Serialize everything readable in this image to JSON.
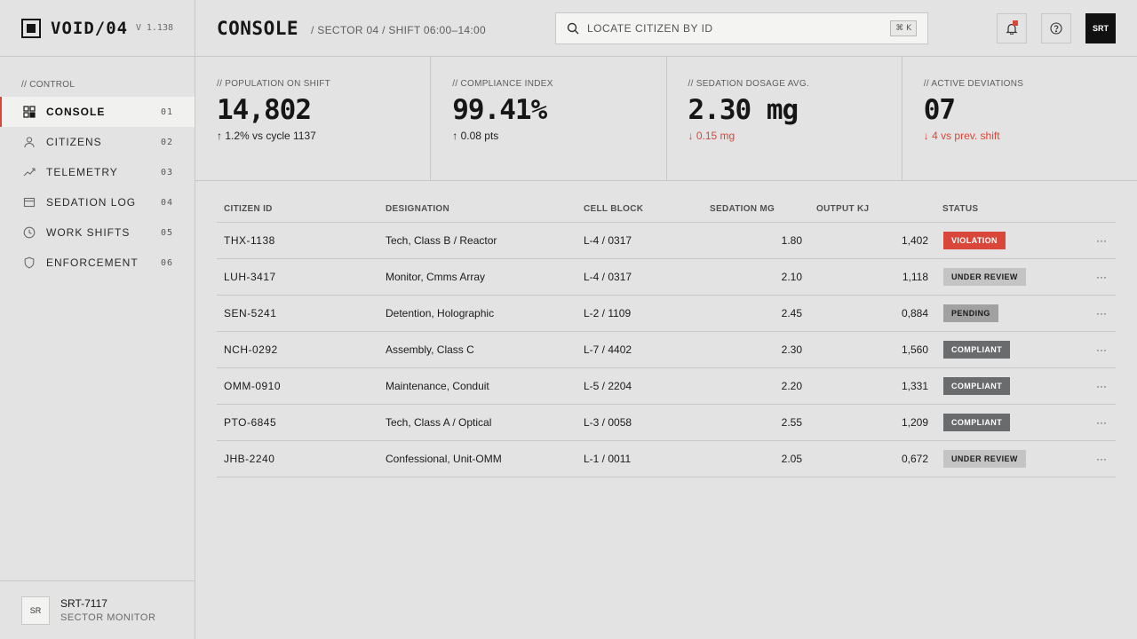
{
  "brand": {
    "name": "VOID/04",
    "version": "V 1.138"
  },
  "nav": {
    "heading": "// CONTROL",
    "items": [
      {
        "label": "CONSOLE",
        "num": "01",
        "icon": "dashboard-icon",
        "active": true
      },
      {
        "label": "CITIZENS",
        "num": "02",
        "icon": "user-icon"
      },
      {
        "label": "TELEMETRY",
        "num": "03",
        "icon": "trend-icon"
      },
      {
        "label": "SEDATION LOG",
        "num": "04",
        "icon": "log-icon"
      },
      {
        "label": "WORK SHIFTS",
        "num": "05",
        "icon": "clock-icon"
      },
      {
        "label": "ENFORCEMENT",
        "num": "06",
        "icon": "shield-icon"
      }
    ]
  },
  "user": {
    "avatar": "SR",
    "id": "SRT-7117",
    "role": "SECTOR MONITOR"
  },
  "header": {
    "title": "CONSOLE",
    "breadcrumb": "/ SECTOR 04 / SHIFT 06:00–14:00",
    "search_placeholder": "LOCATE CITIZEN BY ID",
    "search_shortcut": "⌘ K",
    "account_label": "SRT"
  },
  "kpis": [
    {
      "label": "// POPULATION ON SHIFT",
      "value": "14,802",
      "delta": "↑ 1.2% vs cycle 1137",
      "trend": "up"
    },
    {
      "label": "// COMPLIANCE INDEX",
      "value": "99.41%",
      "delta": "↑ 0.08 pts",
      "trend": "up"
    },
    {
      "label": "// SEDATION DOSAGE AVG.",
      "value": "2.30 mg",
      "delta": "↓ 0.15 mg",
      "trend": "down"
    },
    {
      "label": "// ACTIVE DEVIATIONS",
      "value": "07",
      "delta": "↓ 4 vs prev. shift",
      "trend": "down"
    }
  ],
  "table": {
    "columns": [
      "CITIZEN ID",
      "DESIGNATION",
      "CELL BLOCK",
      "SEDATION MG",
      "OUTPUT KJ",
      "STATUS"
    ],
    "rows": [
      {
        "id": "THX-1138",
        "designation": "Tech, Class B / Reactor",
        "block": "L-4 / 0317",
        "sedation": "1.80",
        "output": "1,402",
        "status": "VIOLATION",
        "status_kind": "violation"
      },
      {
        "id": "LUH-3417",
        "designation": "Monitor, Cmms Array",
        "block": "L-4 / 0317",
        "sedation": "2.10",
        "output": "1,118",
        "status": "UNDER REVIEW",
        "status_kind": "review"
      },
      {
        "id": "SEN-5241",
        "designation": "Detention, Holographic",
        "block": "L-2 / 1109",
        "sedation": "2.45",
        "output": "0,884",
        "status": "PENDING",
        "status_kind": "pending"
      },
      {
        "id": "NCH-0292",
        "designation": "Assembly, Class C",
        "block": "L-7 / 4402",
        "sedation": "2.30",
        "output": "1,560",
        "status": "COMPLIANT",
        "status_kind": "compliant"
      },
      {
        "id": "OMM-0910",
        "designation": "Maintenance, Conduit",
        "block": "L-5 / 2204",
        "sedation": "2.20",
        "output": "1,331",
        "status": "COMPLIANT",
        "status_kind": "compliant"
      },
      {
        "id": "PTO-6845",
        "designation": "Tech, Class A / Optical",
        "block": "L-3 / 0058",
        "sedation": "2.55",
        "output": "1,209",
        "status": "COMPLIANT",
        "status_kind": "compliant"
      },
      {
        "id": "JHB-2240",
        "designation": "Confessional, Unit-OMM",
        "block": "L-1 / 0011",
        "sedation": "2.05",
        "output": "0,672",
        "status": "UNDER REVIEW",
        "status_kind": "review"
      }
    ],
    "row_action": "···"
  },
  "colors": {
    "accent": "#d8473a",
    "background": "#e2e3e2",
    "compliant": "#6a6b6c"
  }
}
